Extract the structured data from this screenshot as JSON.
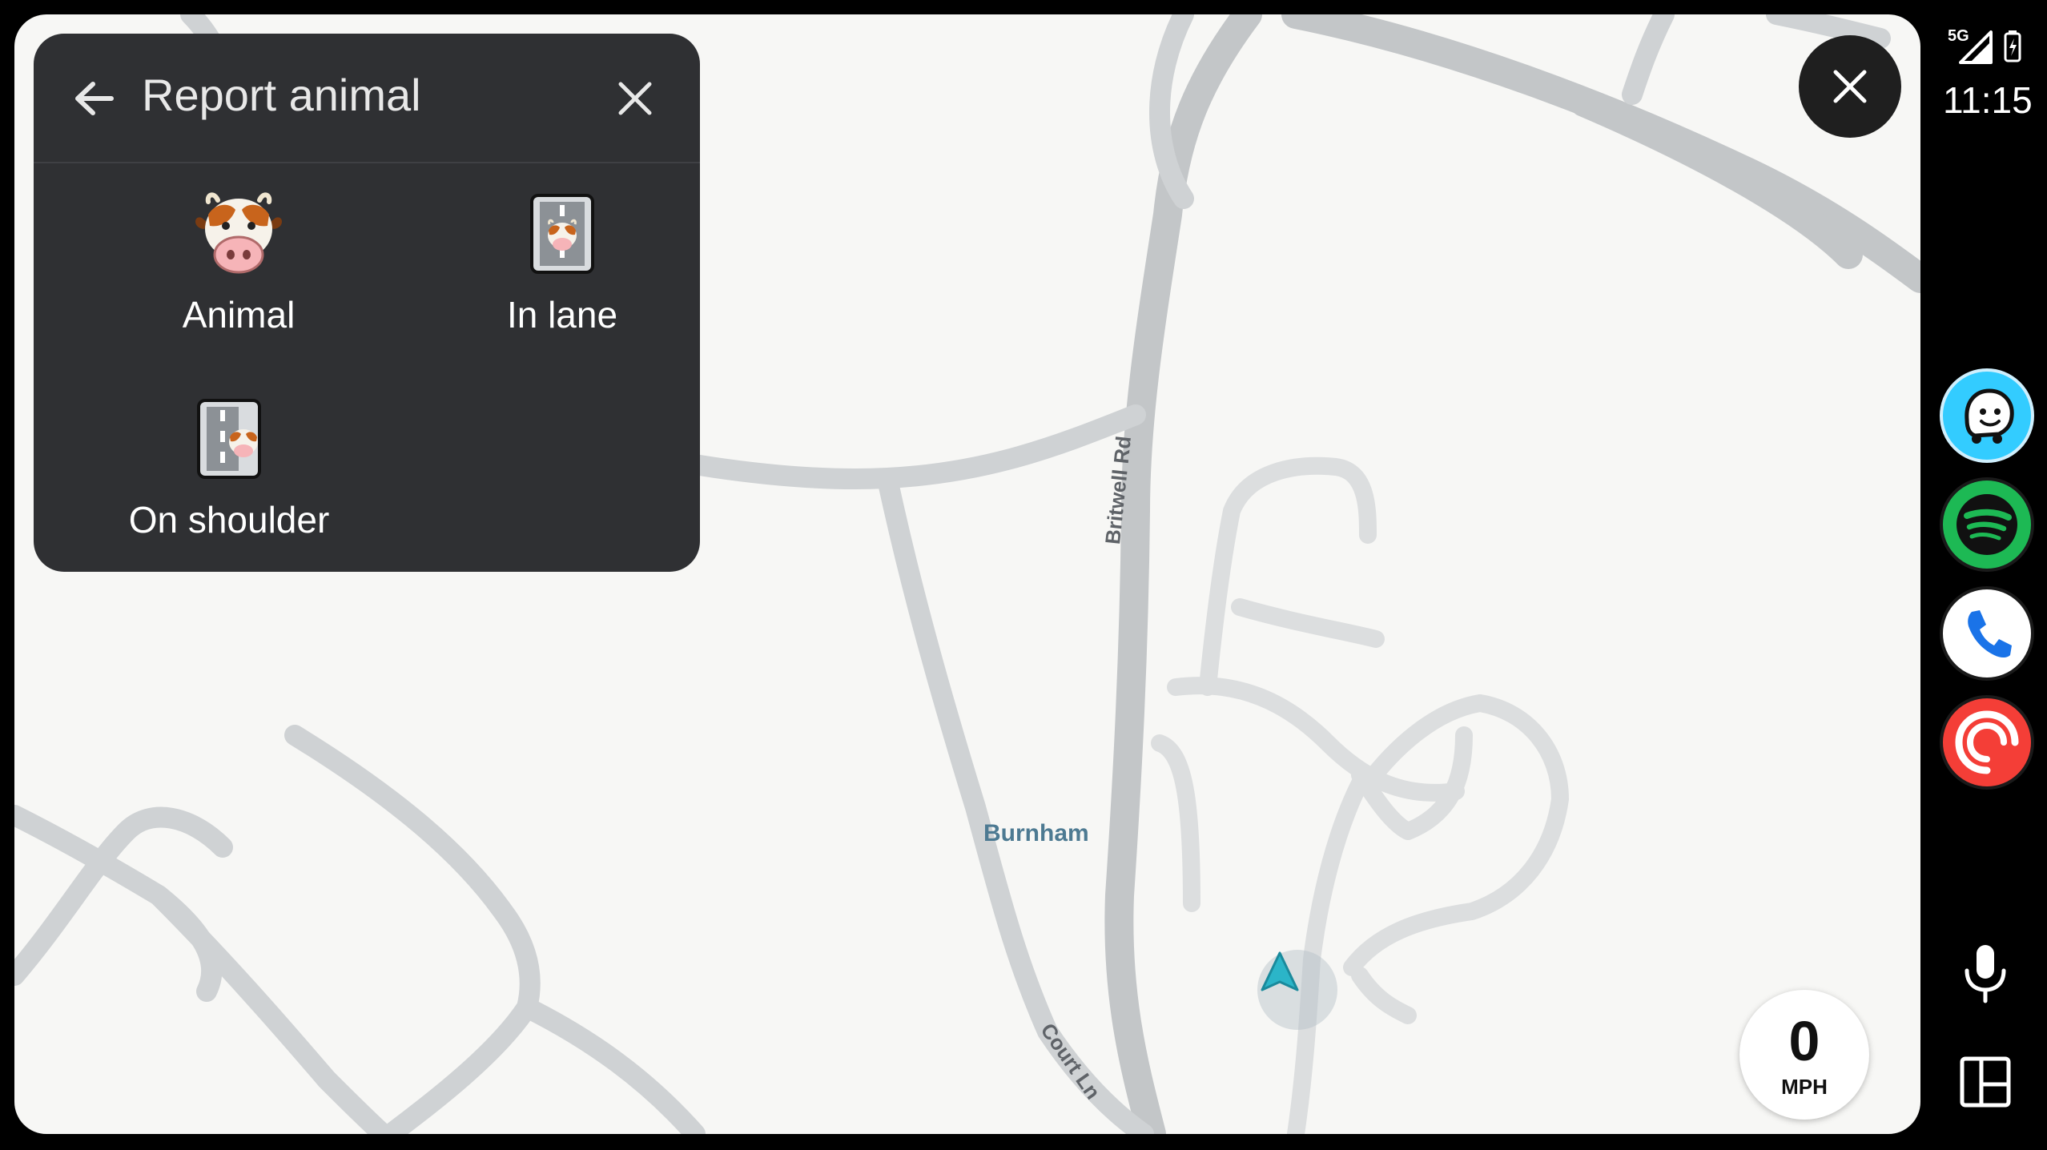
{
  "panel": {
    "title": "Report animal",
    "options": [
      {
        "label": "Animal",
        "icon": "cow-icon"
      },
      {
        "label": "In lane",
        "icon": "animal-in-lane-icon"
      },
      {
        "label": "On shoulder",
        "icon": "animal-on-shoulder-icon"
      }
    ]
  },
  "map": {
    "road_labels": {
      "britwell": "Britwell Rd",
      "court": "Court Ln"
    },
    "place_label": "Burnham"
  },
  "speed": {
    "value": "0",
    "unit": "MPH"
  },
  "status": {
    "network": "5G",
    "time": "11:15"
  },
  "rail_apps": [
    {
      "name": "Waze",
      "icon": "waze-icon",
      "color": "#33ccff"
    },
    {
      "name": "Spotify",
      "icon": "spotify-icon",
      "color": "#1db954"
    },
    {
      "name": "Phone",
      "icon": "phone-icon",
      "color": "#1a73e8"
    },
    {
      "name": "Pocket Casts",
      "icon": "pocket-casts-icon",
      "color": "#f43e37"
    }
  ],
  "colors": {
    "panel_bg": "#2f3033",
    "map_bg": "#f7f7f5",
    "position_arrow": "#2bb5c8"
  }
}
